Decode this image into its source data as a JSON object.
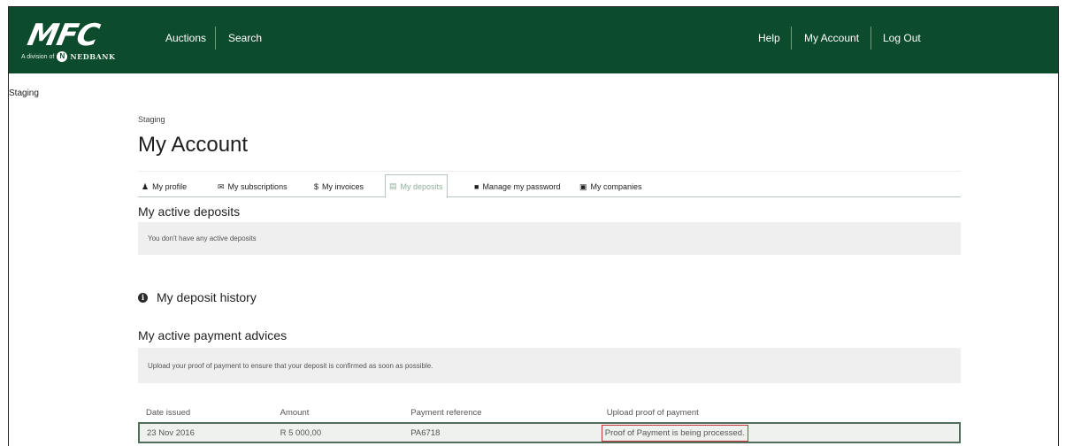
{
  "header": {
    "logo_text": "MFC",
    "logo_sub": "A division of",
    "logo_brand": "NEDBANK",
    "nav_left": [
      "Auctions",
      "Search"
    ],
    "nav_right": [
      "Help",
      "My Account",
      "Log Out"
    ]
  },
  "env_label": "Staging",
  "breadcrumb": "Staging",
  "page_title": "My Account",
  "tabs": [
    {
      "label": "My profile",
      "icon": "user-icon"
    },
    {
      "label": "My subscriptions",
      "icon": "envelope-icon"
    },
    {
      "label": "My invoices",
      "icon": "dollar-icon"
    },
    {
      "label": "My deposits",
      "icon": "money-icon",
      "active": true
    },
    {
      "label": "Manage my password",
      "icon": "lock-icon"
    },
    {
      "label": "My companies",
      "icon": "briefcase-icon"
    }
  ],
  "active_deposits": {
    "heading": "My active deposits",
    "empty_text": "You don't have any active deposits"
  },
  "deposit_history": "My deposit history",
  "payment_advices": {
    "heading": "My active payment advices",
    "info_text": "Upload your proof of payment to ensure that your deposit is confirmed as soon as possible.",
    "columns": [
      "Date issued",
      "Amount",
      "Payment reference",
      "Upload proof of payment"
    ],
    "rows": [
      {
        "date": "23 Nov 2016",
        "amount": "R 5 000,00",
        "reference": "PA6718",
        "status": "Proof of Payment is being processed."
      }
    ]
  },
  "colors": {
    "navbar": "#0c4b2b",
    "highlight": "#c0373d"
  }
}
